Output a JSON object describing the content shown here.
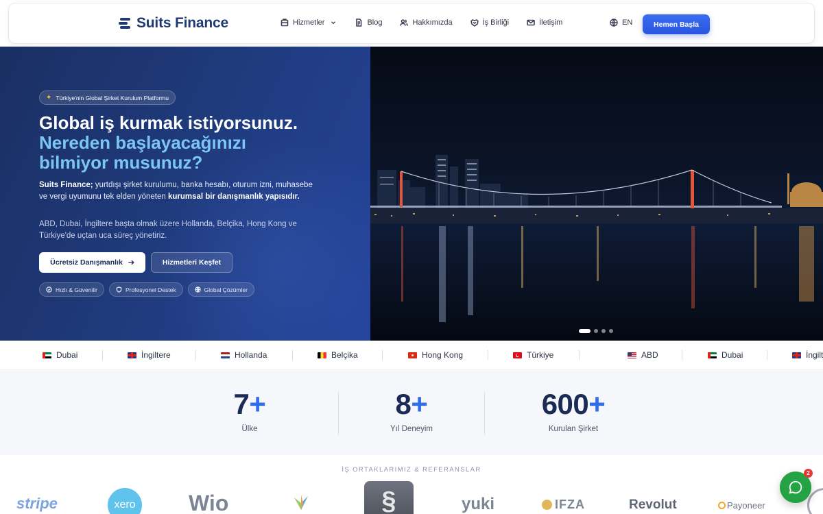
{
  "header": {
    "brand": "Suits Finance",
    "nav": [
      {
        "label": "Hizmetler",
        "icon": "building-icon",
        "dropdown": true
      },
      {
        "label": "Blog",
        "icon": "document-icon"
      },
      {
        "label": "Hakkımızda",
        "icon": "users-icon"
      },
      {
        "label": "İş Birliği",
        "icon": "handshake-icon"
      },
      {
        "label": "İletişim",
        "icon": "mail-icon"
      }
    ],
    "language": "EN",
    "cta_label": "Hemen Başla",
    "colors": {
      "brand": "#1f3a73",
      "cta": "#2f5ee8"
    }
  },
  "hero": {
    "tag": "Türkiye'nin Global Şirket Kurulum Platformu",
    "title_line1": "Global iş kurmak istiyorsunuz.",
    "title_line2": "Nereden başlayacağınızı",
    "title_line3": "bilmiyor musunuz?",
    "p1_lead": "Suits Finance;",
    "p1_text": " yurtdışı şirket kurulumu, banka hesabı, oturum izni, muhasebe ve vergi uyumunu tek elden yöneten ",
    "p1_bold": "kurumsal bir danışmanlık yapısıdır.",
    "p2": "ABD, Dubai, İngiltere başta olmak üzere Hollanda, Belçika, Hong Kong ve Türkiye'de uçtan uca süreç yönetiriz.",
    "primary_button": "Ücretsiz Danışmanlık",
    "secondary_button": "Hizmetleri Keşfet",
    "pills": [
      "Hızlı & Güvenilir",
      "Profesyonel Destek",
      "Global Çözümler"
    ],
    "slider": {
      "slides": 4,
      "active": 1
    },
    "colors": {
      "accent_text": "#7cc6f5",
      "bg": "#1f3a7a"
    }
  },
  "countries": [
    "Dubai",
    "İngiltere",
    "Hollanda",
    "Belçika",
    "Hong Kong",
    "Türkiye",
    "ABD",
    "Dubai",
    "İngiltere"
  ],
  "stats": [
    {
      "value": "7",
      "suffix": "+",
      "label": "Ülke"
    },
    {
      "value": "8",
      "suffix": "+",
      "label": "Yıl Deneyim"
    },
    {
      "value": "600",
      "suffix": "+",
      "label": "Kurulan Şirket"
    }
  ],
  "partners": {
    "title": "İŞ ORTAKLARIMIZ & REFERANSLAR",
    "logos": [
      "stripe",
      "xero",
      "Wio",
      "IFZA",
      "yuki",
      "IFZA",
      "Revolut",
      "Payoneer"
    ]
  },
  "chat": {
    "unread": "2"
  }
}
